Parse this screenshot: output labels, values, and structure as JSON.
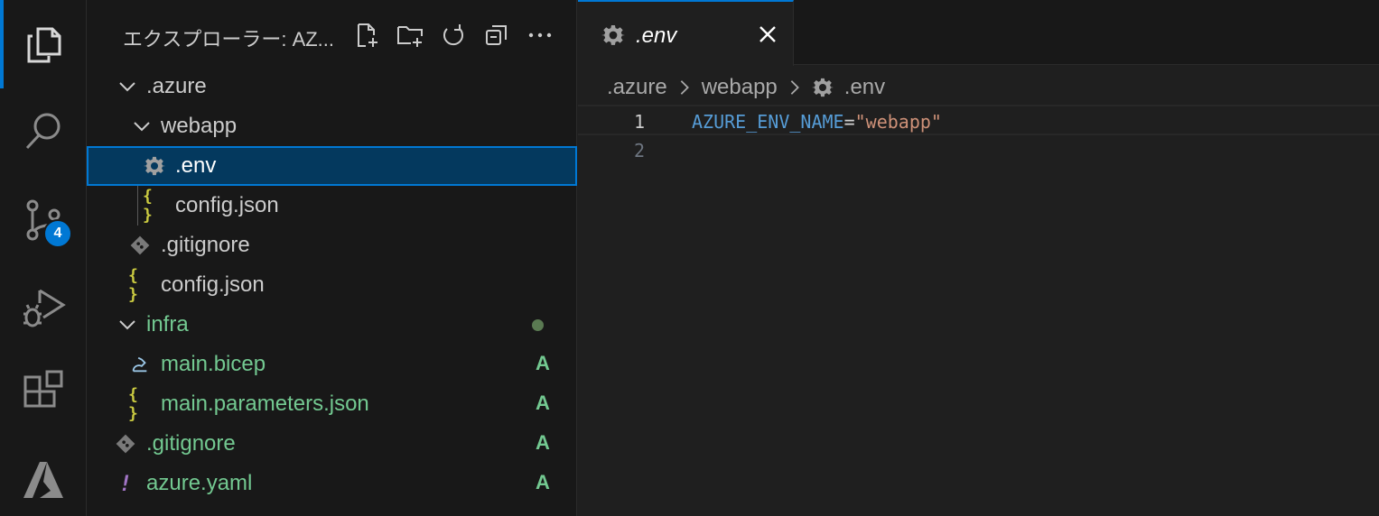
{
  "activity_bar": {
    "items": [
      "explorer-icon",
      "search-icon",
      "source-control-icon",
      "run-debug-icon",
      "extensions-icon",
      "azure-icon"
    ],
    "source_control_badge": "4",
    "accent_color": "#0078d4"
  },
  "sidebar": {
    "title": "エクスプローラー: AZ...",
    "actions": [
      "new-file-icon",
      "new-folder-icon",
      "refresh-icon",
      "collapse-all-icon",
      "more-icon"
    ],
    "tree": [
      {
        "label": ".azure",
        "type": "folder",
        "expanded": true
      },
      {
        "label": "webapp",
        "type": "folder",
        "expanded": true
      },
      {
        "label": ".env",
        "type": "file",
        "icon": "gear-icon",
        "selected": true
      },
      {
        "label": "config.json",
        "type": "file",
        "icon": "json-icon",
        "icon_text": "{ }"
      },
      {
        "label": ".gitignore",
        "type": "file",
        "icon": "git-icon"
      },
      {
        "label": "config.json",
        "type": "file",
        "icon": "json-icon",
        "icon_text": "{ }"
      },
      {
        "label": "infra",
        "type": "folder",
        "expanded": true,
        "status": "modified-dot"
      },
      {
        "label": "main.bicep",
        "type": "file",
        "icon": "bicep-icon",
        "status": "A"
      },
      {
        "label": "main.parameters.json",
        "type": "file",
        "icon": "json-icon",
        "icon_text": "{ }",
        "status": "A"
      },
      {
        "label": ".gitignore",
        "type": "file",
        "icon": "git-icon",
        "status": "A"
      },
      {
        "label": "azure.yaml",
        "type": "file",
        "icon": "yaml-icon",
        "icon_text": "!",
        "status": "A"
      }
    ]
  },
  "editor": {
    "tab": {
      "label": ".env"
    },
    "breadcrumb": [
      ".azure",
      "webapp",
      ".env"
    ],
    "lines": [
      {
        "number": "1",
        "key": "AZURE_ENV_NAME",
        "op": "=",
        "value": "\"webapp\""
      },
      {
        "number": "2"
      }
    ]
  }
}
